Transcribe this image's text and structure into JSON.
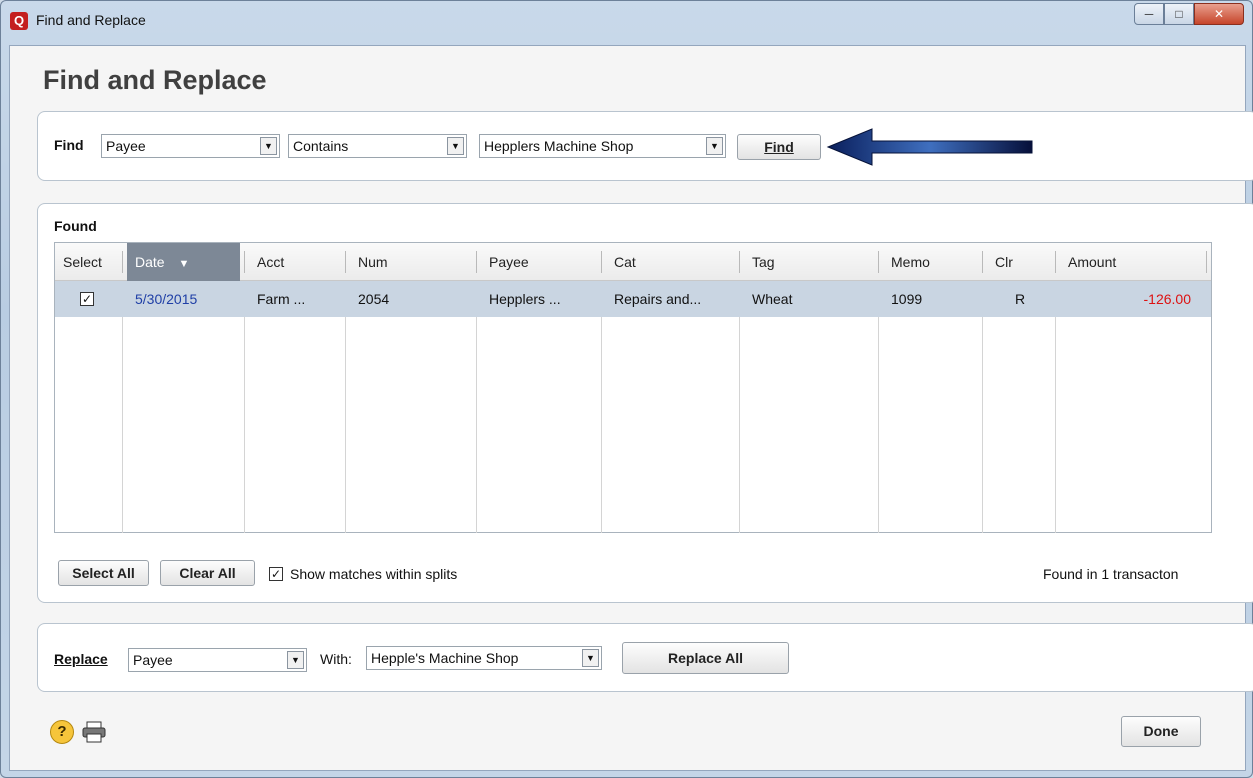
{
  "window": {
    "title": "Find and Replace",
    "app_icon": "Q"
  },
  "heading": "Find and Replace",
  "find": {
    "label": "Find",
    "field": "Payee",
    "operator": "Contains",
    "value": "Hepplers Machine Shop",
    "button": "Find"
  },
  "found": {
    "label": "Found",
    "columns": [
      "Select",
      "Date",
      "Acct",
      "Num",
      "Payee",
      "Cat",
      "Tag",
      "Memo",
      "Clr",
      "Amount"
    ],
    "rows": [
      {
        "selected": true,
        "date": "5/30/2015",
        "acct": "Farm ...",
        "num": "2054",
        "payee": "Hepplers ...",
        "cat": "Repairs and...",
        "tag": "Wheat",
        "memo": "1099",
        "clr": "R",
        "amount": "-126.00"
      }
    ],
    "select_all": "Select All",
    "clear_all": "Clear All",
    "show_matches": "Show matches within splits",
    "show_matches_checked": true,
    "status": "Found in 1 transacton"
  },
  "replace": {
    "label": "Replace",
    "field": "Payee",
    "with_label": "With:",
    "value": "Hepple's Machine Shop",
    "button": "Replace All"
  },
  "footer": {
    "done": "Done",
    "help_icon": "help-icon",
    "print_icon": "printer-icon"
  },
  "colors": {
    "accent": "#0d2a73",
    "negative": "#dd1111",
    "selected_row": "#c9d5e2"
  }
}
